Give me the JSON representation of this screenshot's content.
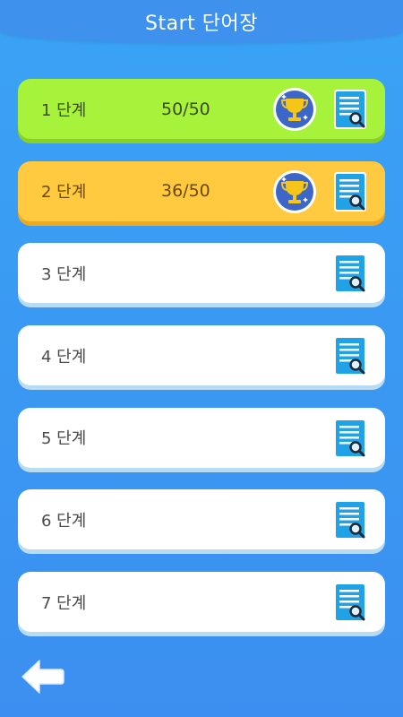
{
  "header": {
    "title": "Start 단어장"
  },
  "levels": [
    {
      "label": "1 단계",
      "score": "50/50",
      "trophy": true,
      "state": "done"
    },
    {
      "label": "2 단계",
      "score": "36/50",
      "trophy": true,
      "state": "partial"
    },
    {
      "label": "3 단계",
      "score": "",
      "trophy": false,
      "state": "locked"
    },
    {
      "label": "4 단계",
      "score": "",
      "trophy": false,
      "state": "locked"
    },
    {
      "label": "5 단계",
      "score": "",
      "trophy": false,
      "state": "locked"
    },
    {
      "label": "6 단계",
      "score": "",
      "trophy": false,
      "state": "locked"
    },
    {
      "label": "7 단계",
      "score": "",
      "trophy": false,
      "state": "locked"
    }
  ],
  "icons": {
    "trophy": "trophy-icon",
    "wordlist": "wordlist-search-icon",
    "back": "back-arrow-icon"
  },
  "colors": {
    "background": "#3b97f2",
    "done": "#a7f23b",
    "partial": "#ffc940",
    "default": "#ffffff",
    "icon_blue": "#1fa3e6"
  }
}
